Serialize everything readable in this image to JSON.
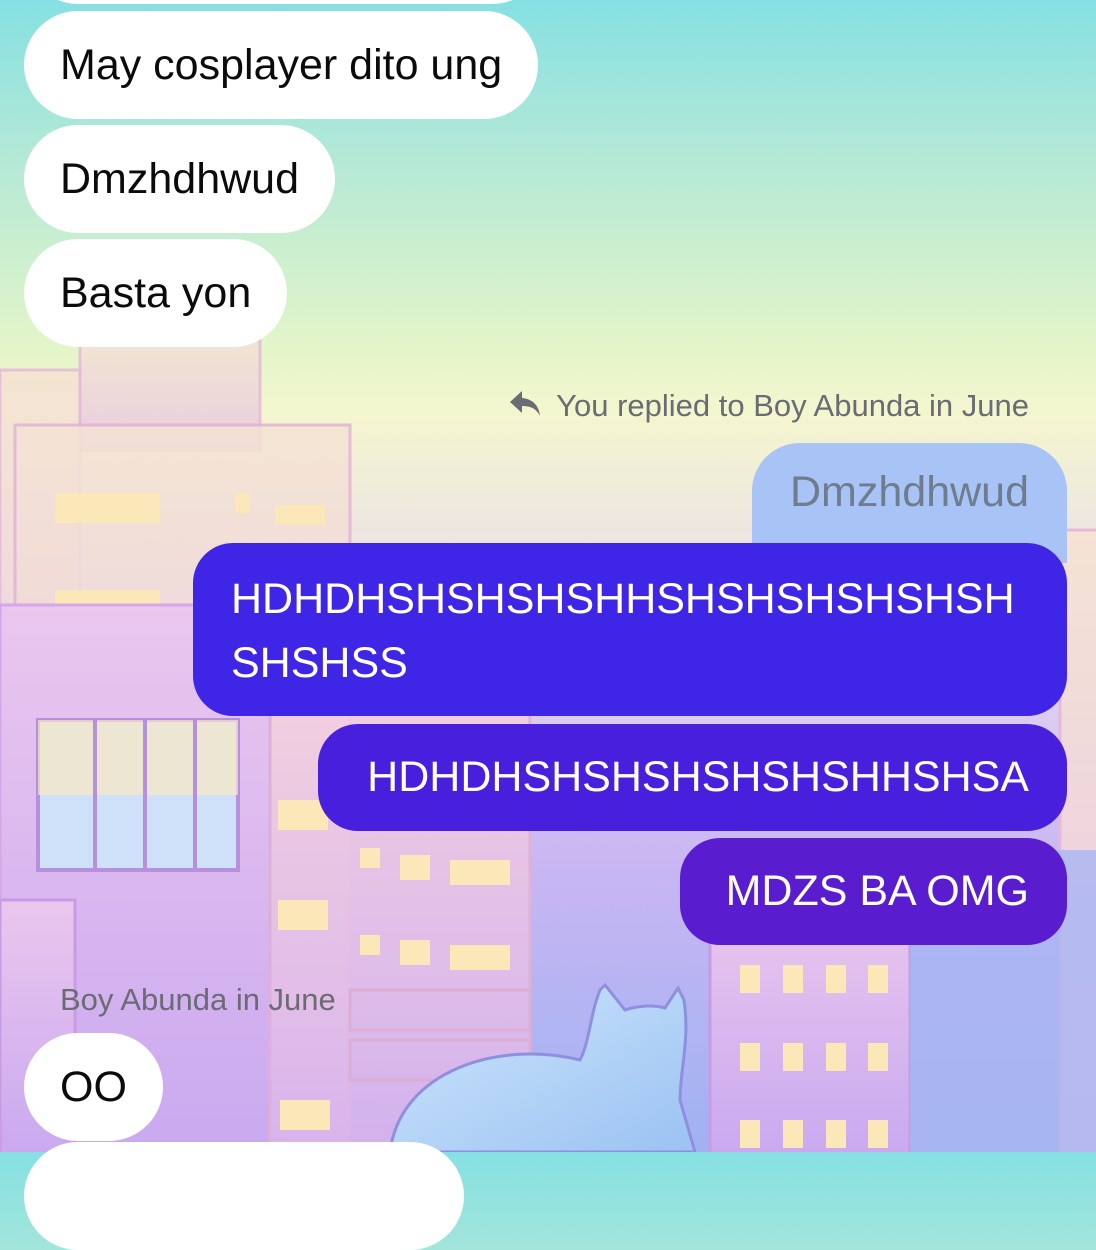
{
  "incoming_top": [
    {
      "text": "May cosplayer dito ung"
    },
    {
      "text": "Dmzhdhwud"
    },
    {
      "text": "Basta yon"
    }
  ],
  "reply_meta": {
    "icon": "reply-arrow-icon",
    "text": "You replied to Boy Abunda in June"
  },
  "quoted_message": {
    "text": "Dmzhdhwud"
  },
  "outgoing": [
    {
      "line1": "HDHDHSHSHSHSHHSHSHSHSHSHSH",
      "line2": "SHSHSS"
    },
    {
      "text": "HDHDHSHSHSHSHSHSHHSHSA"
    },
    {
      "text": "MDZS BA OMG"
    }
  ],
  "sender_meta": {
    "text": "Boy Abunda in June"
  },
  "incoming_bottom": [
    {
      "text": "OO"
    }
  ],
  "colors": {
    "incoming_bubble": "#ffffff",
    "quoted_bubble": "#a8c4f6",
    "outgoing_gradient_top": "#3a2ce6",
    "outgoing_gradient_bottom": "#6418c8"
  }
}
